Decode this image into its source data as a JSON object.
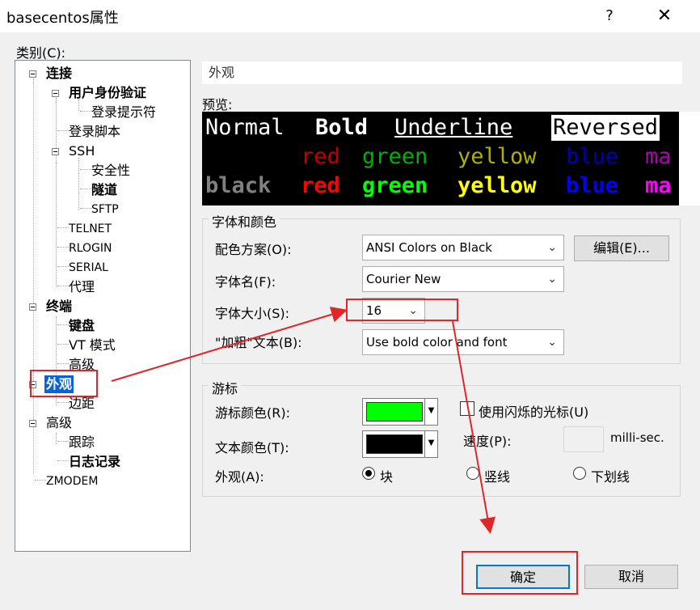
{
  "window": {
    "title": "basecentos属性",
    "help": "?",
    "close": "✕"
  },
  "category_label": "类别(C):",
  "tree": {
    "connect": "连接",
    "auth": "用户身份验证",
    "login_prompt": "登录提示符",
    "login_script": "登录脚本",
    "ssh": "SSH",
    "security": "安全性",
    "tunnel": "隧道",
    "sftp": "SFTP",
    "telnet": "TELNET",
    "rlogin": "RLOGIN",
    "serial": "SERIAL",
    "proxy": "代理",
    "terminal": "终端",
    "keyboard": "键盘",
    "vt_mode": "VT 模式",
    "advanced_term": "高级",
    "appearance": "外观",
    "margin": "边距",
    "advanced": "高级",
    "trace": "跟踪",
    "log": "日志记录",
    "zmodem": "ZMODEM"
  },
  "section_header": "外观",
  "preview": {
    "label": "预览:",
    "row1": [
      "Normal",
      "Bold",
      "Underline",
      "Reversed"
    ],
    "row2": [
      "red",
      "green",
      "yellow",
      "blue",
      "ma"
    ],
    "row3": [
      "black",
      "red",
      "green",
      "yellow",
      "blue",
      "ma"
    ]
  },
  "font_color_group": {
    "title": "字体和颜色",
    "scheme_label": "配色方案(O):",
    "scheme_value": "ANSI Colors on Black",
    "edit_button": "编辑(E)...",
    "font_label": "字体名(F):",
    "font_value": "Courier New",
    "size_label": "字体大小(S):",
    "size_value": "16",
    "bold_label": "\"加粗\"文本(B):",
    "bold_value": "Use bold color and font"
  },
  "cursor_group": {
    "title": "游标",
    "cursor_color_label": "游标颜色(R):",
    "text_color_label": "文本颜色(T):",
    "appearance_label": "外观(A):",
    "blink_label": "使用闪烁的光标(U)",
    "speed_label": "速度(P):",
    "speed_unit": "milli-sec.",
    "shape_block": "块",
    "shape_vertical": "竖线",
    "shape_underline": "下划线"
  },
  "buttons": {
    "ok": "确定",
    "cancel": "取消"
  },
  "colors": {
    "cursor_color": "#00ff00",
    "text_color": "#000000",
    "annotation_red": "#e0262a",
    "selection_blue": "#0a64d8"
  }
}
